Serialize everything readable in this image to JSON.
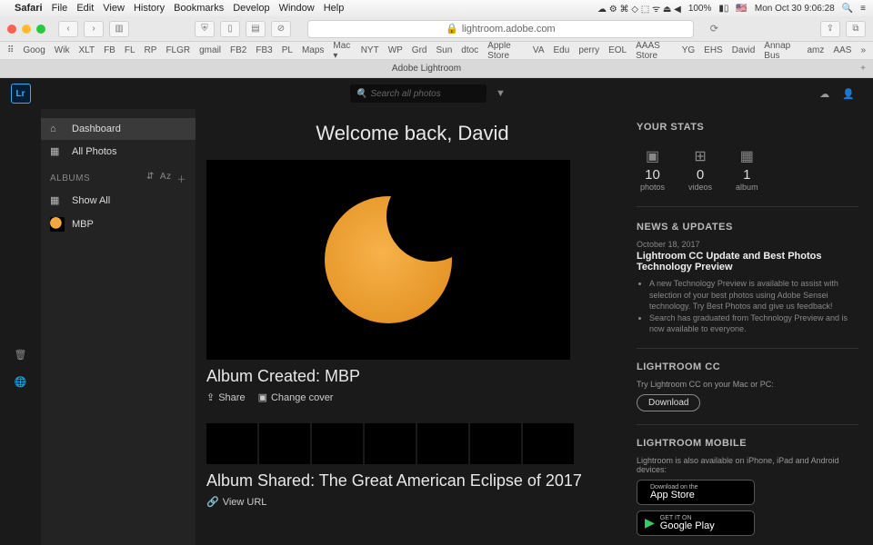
{
  "menubar": {
    "app": "Safari",
    "items": [
      "File",
      "Edit",
      "View",
      "History",
      "Bookmarks",
      "Develop",
      "Window",
      "Help"
    ],
    "battery": "100%",
    "flag": "🇺🇸",
    "datetime": "Mon Oct 30  9:06:28"
  },
  "safari": {
    "address": "lightroom.adobe.com",
    "bookmarks": [
      "Goog",
      "Wik",
      "XLT",
      "FB",
      "FL",
      "RP",
      "FLGR",
      "gmail",
      "FB2",
      "FB3",
      "PL",
      "Maps",
      "Mac ▾",
      "NYT",
      "WP",
      "Grd",
      "Sun",
      "dtoc",
      "Apple Store",
      "VA",
      "Edu",
      "perry",
      "EOL",
      "AAAS Store",
      "YG",
      "EHS",
      "David",
      "Annap Bus",
      "amz",
      "AAS"
    ],
    "tab_title": "Adobe Lightroom"
  },
  "lr": {
    "search_placeholder": "Search all photos",
    "sidebar": {
      "dashboard": "Dashboard",
      "all_photos": "All Photos",
      "albums_header": "ALBUMS",
      "show_all": "Show All",
      "album_mbp": "MBP"
    },
    "main": {
      "welcome": "Welcome back, David",
      "album_created_title": "Album Created: MBP",
      "share": "Share",
      "change_cover": "Change cover",
      "album_shared_title": "Album Shared: The Great American Eclipse of 2017",
      "view_url": "View URL"
    },
    "right": {
      "stats_header": "YOUR STATS",
      "photos_n": "10",
      "photos_l": "photos",
      "videos_n": "0",
      "videos_l": "videos",
      "albums_n": "1",
      "albums_l": "album",
      "news_header": "NEWS & UPDATES",
      "news_date": "October 18, 2017",
      "news_headline": "Lightroom CC Update and Best Photos Technology Preview",
      "news_b1": "A new Technology Preview is available to assist with selection of your best photos using Adobe Sensei technology. Try Best Photos and give us feedback!",
      "news_b2": "Search has graduated from Technology Preview and is now available to everyone.",
      "cc_header": "LIGHTROOM CC",
      "cc_desc": "Try Lightroom CC on your Mac or PC:",
      "cc_download": "Download",
      "mobile_header": "LIGHTROOM MOBILE",
      "mobile_desc": "Lightroom is also available on iPhone, iPad and Android devices:",
      "appstore_top": "Download on the",
      "appstore_name": "App Store",
      "play_top": "GET IT ON",
      "play_name": "Google Play"
    }
  }
}
